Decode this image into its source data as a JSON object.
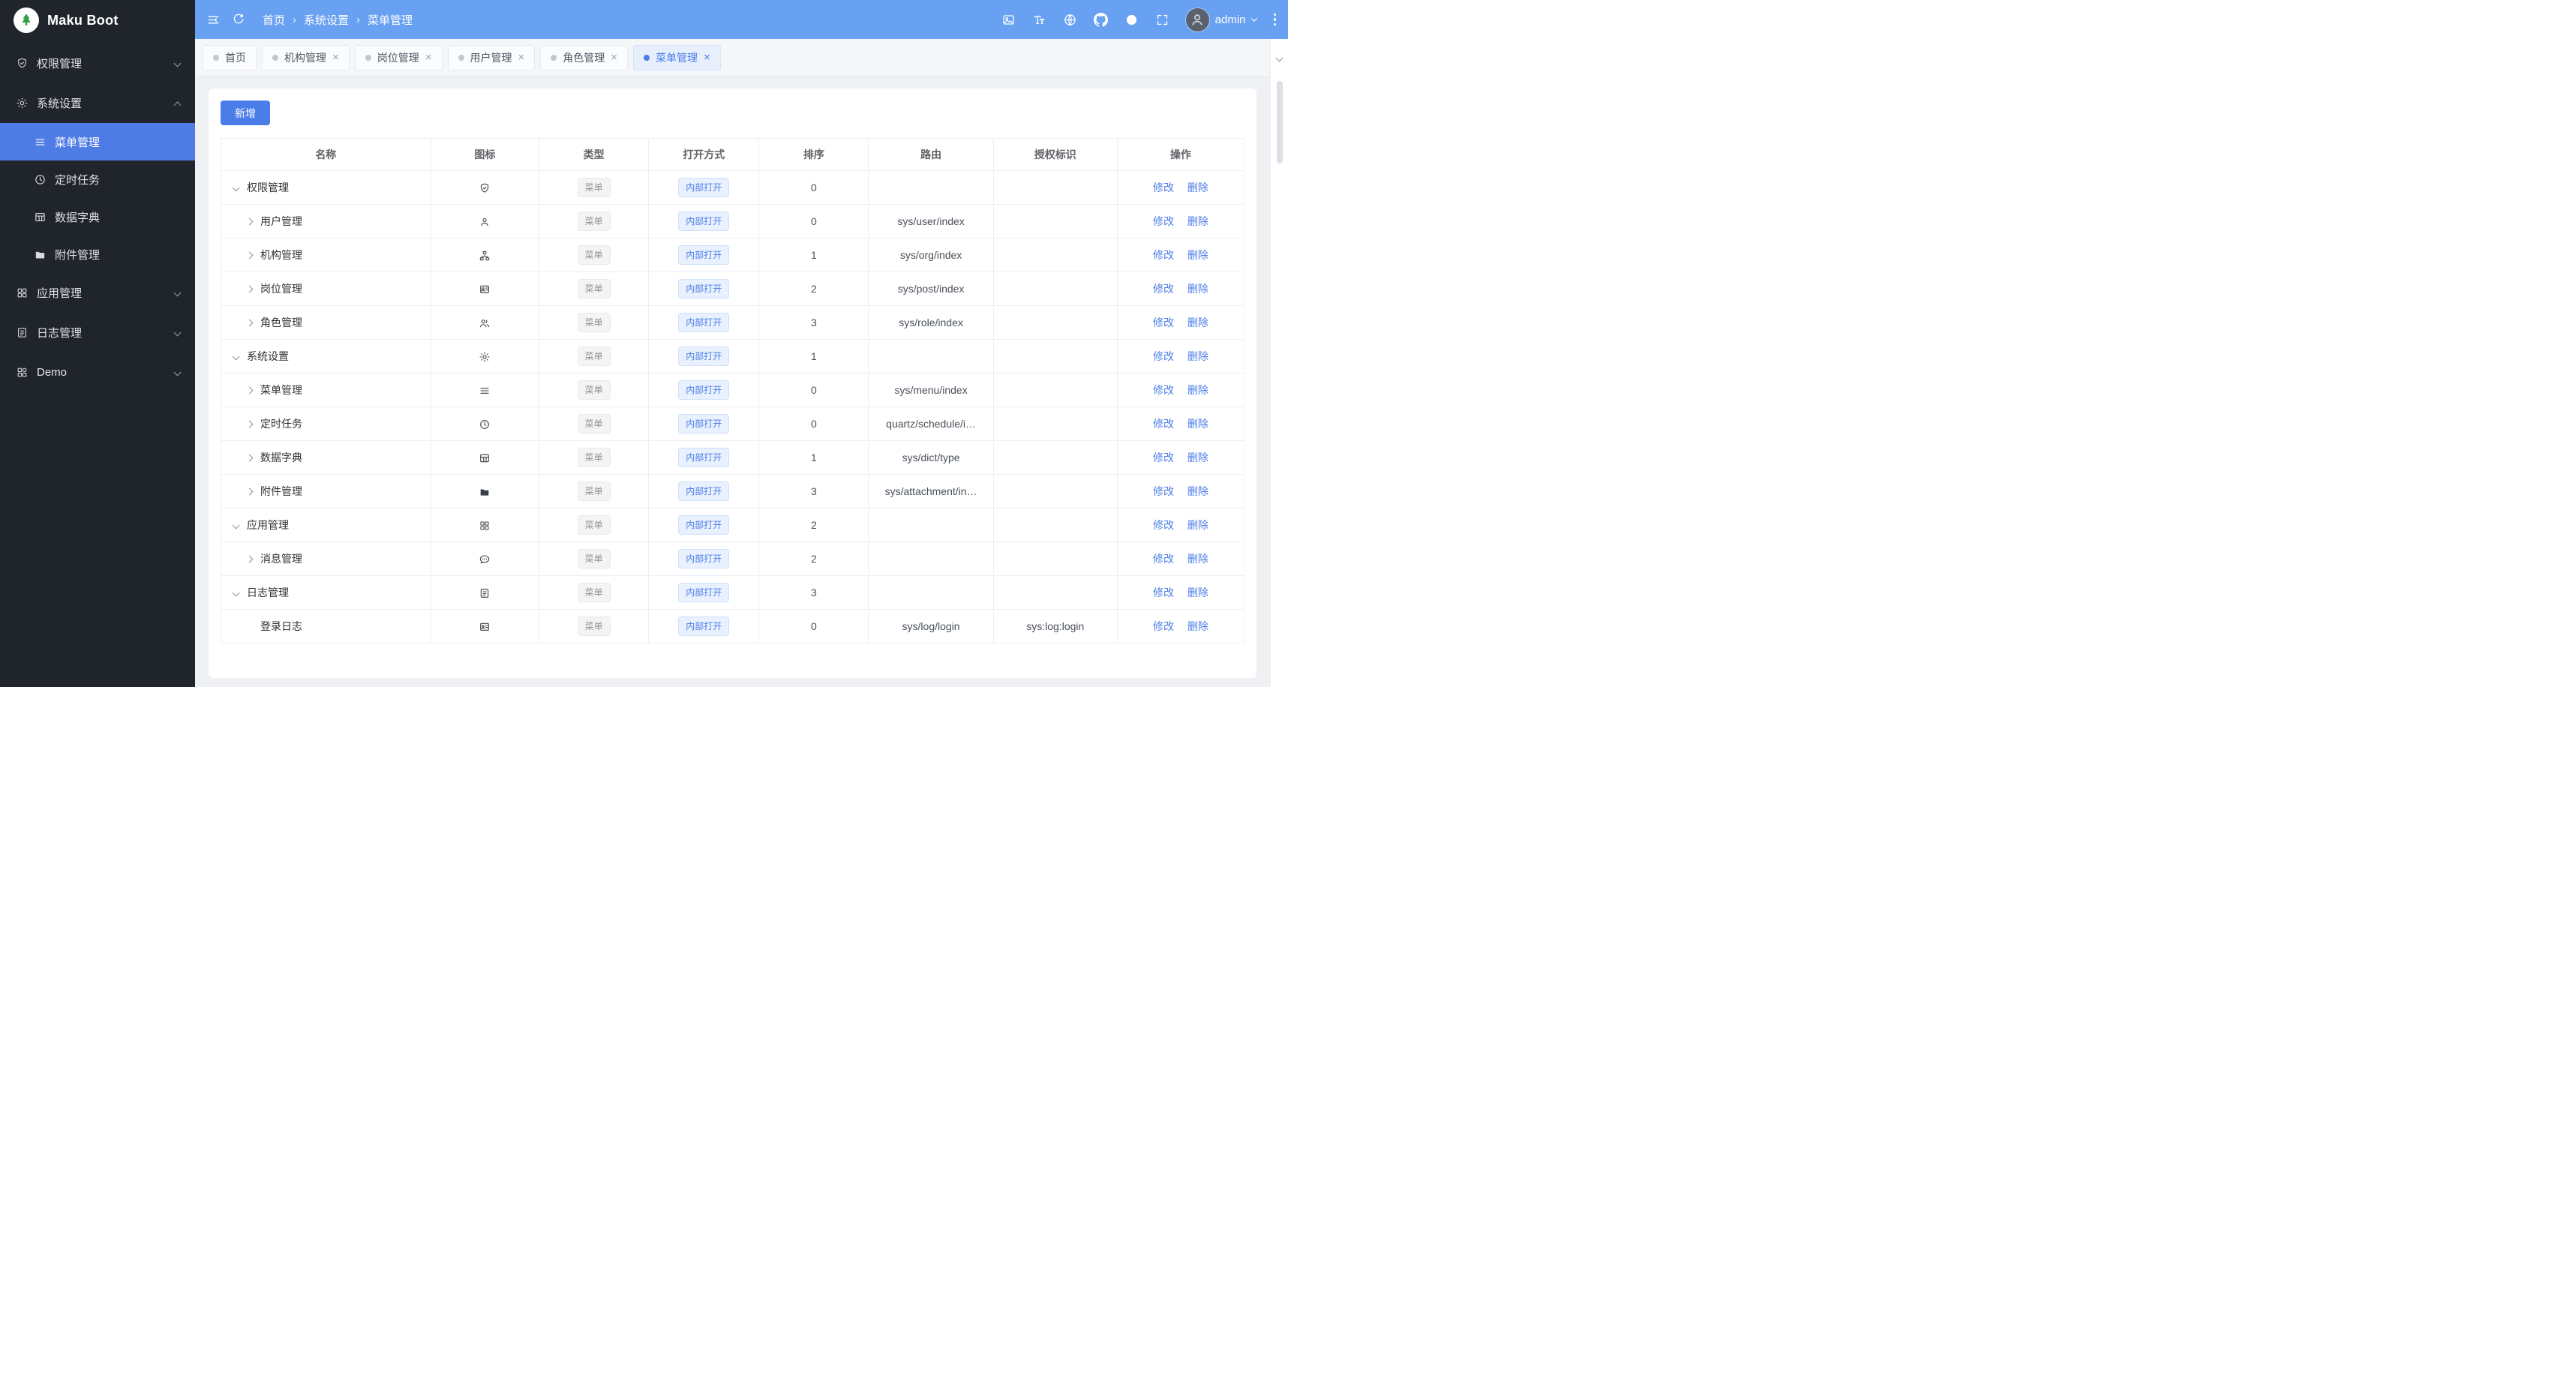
{
  "colors": {
    "primary": "#4a7de8",
    "header_bg": "#68a0f2",
    "sidebar_bg": "#20242b",
    "sidebar_active_bg": "#4e7be4",
    "content_bg": "#eef0f4"
  },
  "sidebar": {
    "logo": "Maku Boot",
    "items": [
      {
        "label": "权限管理",
        "icon": "shield",
        "state": "collapsed"
      },
      {
        "label": "系统设置",
        "icon": "gear",
        "state": "expanded",
        "children": [
          {
            "label": "菜单管理",
            "icon": "menu",
            "active": true
          },
          {
            "label": "定时任务",
            "icon": "clock",
            "active": false
          },
          {
            "label": "数据字典",
            "icon": "dict",
            "active": false
          },
          {
            "label": "附件管理",
            "icon": "folder",
            "active": false
          }
        ]
      },
      {
        "label": "应用管理",
        "icon": "apps",
        "state": "collapsed"
      },
      {
        "label": "日志管理",
        "icon": "log",
        "state": "collapsed"
      },
      {
        "label": "Demo",
        "icon": "apps",
        "state": "collapsed"
      }
    ]
  },
  "header": {
    "breadcrumb": [
      "首页",
      "系统设置",
      "菜单管理"
    ],
    "user": "admin"
  },
  "tabs": [
    {
      "label": "首页",
      "closable": false,
      "active": false
    },
    {
      "label": "机构管理",
      "closable": true,
      "active": false
    },
    {
      "label": "岗位管理",
      "closable": true,
      "active": false
    },
    {
      "label": "用户管理",
      "closable": true,
      "active": false
    },
    {
      "label": "角色管理",
      "closable": true,
      "active": false
    },
    {
      "label": "菜单管理",
      "closable": true,
      "active": true
    }
  ],
  "ui": {
    "close_glyph": "×"
  },
  "toolbar": {
    "add_label": "新增"
  },
  "table": {
    "headers": [
      "名称",
      "图标",
      "类型",
      "打开方式",
      "排序",
      "路由",
      "授权标识",
      "操作"
    ],
    "actions": {
      "edit": "修改",
      "delete": "删除"
    },
    "rows": [
      {
        "name": "权限管理",
        "icon": "shield",
        "indent": 0,
        "expand": "down",
        "type": "菜单",
        "open": "内部打开",
        "sort": "0",
        "route": "",
        "auth": ""
      },
      {
        "name": "用户管理",
        "icon": "user",
        "indent": 1,
        "expand": "right",
        "type": "菜单",
        "open": "内部打开",
        "sort": "0",
        "route": "sys/user/index",
        "auth": ""
      },
      {
        "name": "机构管理",
        "icon": "org",
        "indent": 1,
        "expand": "right",
        "type": "菜单",
        "open": "内部打开",
        "sort": "1",
        "route": "sys/org/index",
        "auth": ""
      },
      {
        "name": "岗位管理",
        "icon": "post",
        "indent": 1,
        "expand": "right",
        "type": "菜单",
        "open": "内部打开",
        "sort": "2",
        "route": "sys/post/index",
        "auth": ""
      },
      {
        "name": "角色管理",
        "icon": "role",
        "indent": 1,
        "expand": "right",
        "type": "菜单",
        "open": "内部打开",
        "sort": "3",
        "route": "sys/role/index",
        "auth": ""
      },
      {
        "name": "系统设置",
        "icon": "gear",
        "indent": 0,
        "expand": "down",
        "type": "菜单",
        "open": "内部打开",
        "sort": "1",
        "route": "",
        "auth": ""
      },
      {
        "name": "菜单管理",
        "icon": "menu",
        "indent": 1,
        "expand": "right",
        "type": "菜单",
        "open": "内部打开",
        "sort": "0",
        "route": "sys/menu/index",
        "auth": ""
      },
      {
        "name": "定时任务",
        "icon": "clock",
        "indent": 1,
        "expand": "right",
        "type": "菜单",
        "open": "内部打开",
        "sort": "0",
        "route": "quartz/schedule/i…",
        "auth": ""
      },
      {
        "name": "数据字典",
        "icon": "dict",
        "indent": 1,
        "expand": "right",
        "type": "菜单",
        "open": "内部打开",
        "sort": "1",
        "route": "sys/dict/type",
        "auth": ""
      },
      {
        "name": "附件管理",
        "icon": "folder",
        "indent": 1,
        "expand": "right",
        "type": "菜单",
        "open": "内部打开",
        "sort": "3",
        "route": "sys/attachment/in…",
        "auth": ""
      },
      {
        "name": "应用管理",
        "icon": "apps",
        "indent": 0,
        "expand": "down",
        "type": "菜单",
        "open": "内部打开",
        "sort": "2",
        "route": "",
        "auth": ""
      },
      {
        "name": "消息管理",
        "icon": "message",
        "indent": 1,
        "expand": "right",
        "type": "菜单",
        "open": "内部打开",
        "sort": "2",
        "route": "",
        "auth": ""
      },
      {
        "name": "日志管理",
        "icon": "log",
        "indent": 0,
        "expand": "down",
        "type": "菜单",
        "open": "内部打开",
        "sort": "3",
        "route": "",
        "auth": ""
      },
      {
        "name": "登录日志",
        "icon": "login",
        "indent": 1,
        "expand": "none",
        "type": "菜单",
        "open": "内部打开",
        "sort": "0",
        "route": "sys/log/login",
        "auth": "sys:log:login"
      }
    ]
  }
}
